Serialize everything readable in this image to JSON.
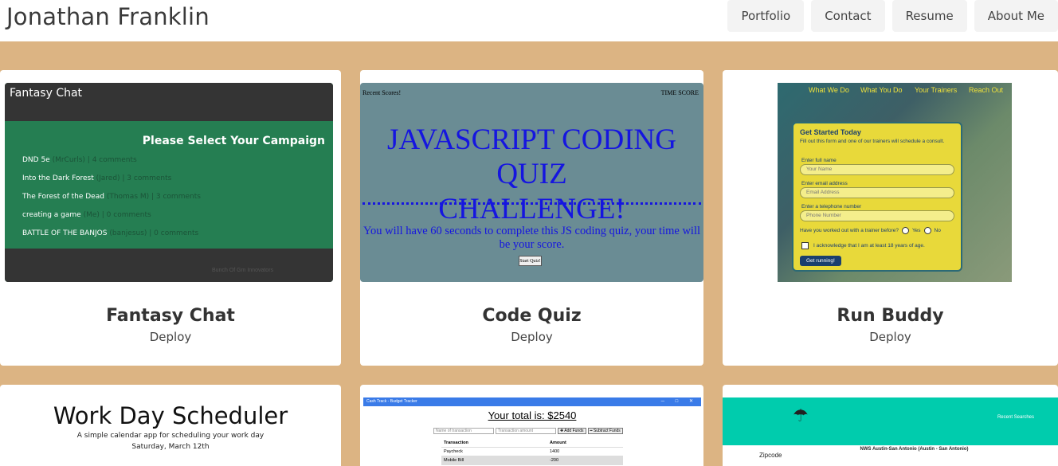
{
  "header": {
    "title": "Jonathan Franklin",
    "nav": [
      "Portfolio",
      "Contact",
      "Resume",
      "About Me"
    ]
  },
  "projects": [
    {
      "title": "Fantasy Chat",
      "link": "Deploy",
      "thumb": {
        "app_title": "Fantasy Chat",
        "heading": "Please Select Your Campaign",
        "items": [
          {
            "name": "DND 5e",
            "meta": " (MrCurls) | 4 comments"
          },
          {
            "name": "Into the Dark Forest",
            "meta": " (Jared) | 3 comments"
          },
          {
            "name": "The Forest of the Dead",
            "meta": " (Thomas M) | 3 comments"
          },
          {
            "name": "creating a game",
            "meta": " (Me) | 0 comments"
          },
          {
            "name": "BATTLE OF THE BANJOS",
            "meta": " (banjesus) | 0 comments"
          }
        ],
        "footer": "Bunch Of Gm Innovators"
      }
    },
    {
      "title": "Code Quiz",
      "link": "Deploy",
      "thumb": {
        "recent": "Recent Scores!",
        "time": "TIME SCORE",
        "headline_1": "JAVASCRIPT CODING QUIZ",
        "headline_2": "CHALLENGE!",
        "description": "You will have 60 seconds to complete this JS coding quiz, your time will be your score.",
        "start": "Start Quiz!"
      }
    },
    {
      "title": "Run Buddy",
      "link": "Deploy",
      "thumb": {
        "nav": [
          "What We Do",
          "What You Do",
          "Your Trainers",
          "Reach Out"
        ],
        "form_title": "Get Started Today",
        "form_sub": "Fill out this form and one of our trainers will schedule a consult.",
        "name_label": "Enter full name",
        "name_placeholder": "Your Name",
        "email_label": "Enter email address",
        "email_placeholder": "Email Address",
        "phone_label": "Enter a telephone number",
        "phone_placeholder": "Phone Number",
        "question": "Have you worked out with a trainer before?",
        "yes": "Yes",
        "no": "No",
        "ack": "I acknowledge that I am at least 18 years of age.",
        "button": "Get running!"
      }
    },
    {
      "title": "Work Day Scheduler",
      "subtitle": "A simple calendar app for scheduling your work day",
      "date": "Saturday, March 12th"
    },
    {
      "thumb": {
        "bar_title": "Cash Track - Budget Tracker",
        "total": "Your total is: $2540",
        "name_placeholder": "Name of transaction",
        "amount_placeholder": "Transaction amount",
        "add": "✚ Add Funds",
        "subtract": "━ Subtract Funds",
        "head": [
          "Transaction",
          "Amount"
        ],
        "rows": [
          [
            "Paycheck",
            "1400"
          ],
          [
            "Mobile Bill",
            "-200"
          ]
        ]
      }
    },
    {
      "thumb": {
        "recent": "Recent Searches",
        "nws": "NWS Austin-San Antonio (Austin - San Antonio)",
        "zipcode": "Zipcode"
      }
    }
  ],
  "colors": {
    "background": "#dcb483",
    "fantasy_green": "#257e52",
    "quiz_blue": "#1515e0",
    "runbuddy_yellow": "#e8d93a",
    "weather_teal": "#00ccad"
  }
}
